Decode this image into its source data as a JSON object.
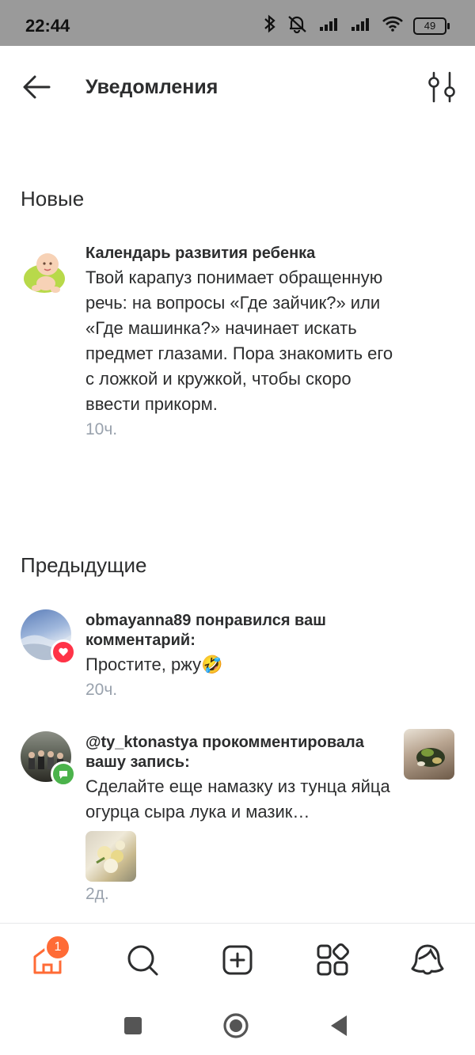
{
  "status_bar": {
    "time": "22:44",
    "battery": "49",
    "icons": [
      "bluetooth-icon",
      "mute-icon",
      "signal-icon",
      "signal-icon",
      "wifi-icon",
      "battery-icon"
    ]
  },
  "header": {
    "title": "Уведомления",
    "back_icon": "arrow-left-icon",
    "filter_icon": "filter-settings-icon"
  },
  "sections": {
    "new": {
      "title": "Новые",
      "items": [
        {
          "author": "Календарь развития ребенка",
          "text": "Твой карапуз понимает обращенную речь: на вопросы «Где зайчик?» или «Где машинка?» начинает искать предмет глазами. Пора знакомить его с ложкой и кружкой, чтобы скоро ввести прикорм.",
          "time": "10ч."
        }
      ]
    },
    "previous": {
      "title": "Предыдущие",
      "items": [
        {
          "author": "obmayanna89 понравился ваш комментарий:",
          "text": "Простите, ржу🤣",
          "time": "20ч.",
          "badge_icon": "heart-icon",
          "badge_color": "#ff3347"
        },
        {
          "author": "@ty_ktonastya прокомментировала вашу запись:",
          "text": "Сделайте еще намазку из тунца яйца огурца сыра  лука и  мазик…",
          "time": "2д.",
          "badge_icon": "comment-icon",
          "badge_color": "#4bb34b"
        }
      ]
    }
  },
  "tab_bar": {
    "home_badge": "1",
    "accent": "#ff6b36",
    "tabs": [
      "home-icon",
      "search-icon",
      "add-post-icon",
      "services-icon",
      "profile-icon"
    ]
  },
  "nav_bar": [
    "square-nav-icon",
    "home-circle-nav-icon",
    "back-triangle-nav-icon"
  ]
}
